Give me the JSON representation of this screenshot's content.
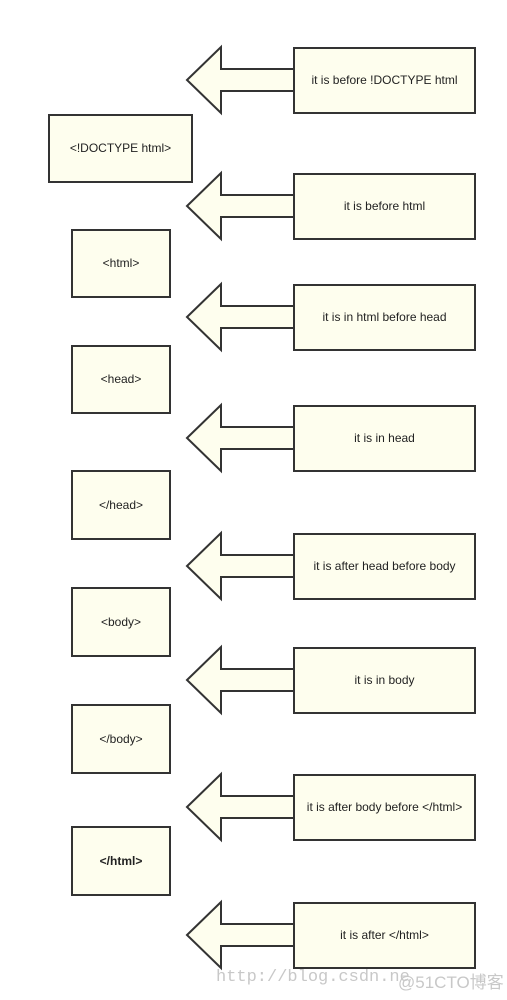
{
  "colors": {
    "fill": "#fefeee",
    "stroke": "#333333"
  },
  "tags": [
    {
      "label": "<!DOCTYPE html>",
      "bold": false
    },
    {
      "label": "<html>",
      "bold": false
    },
    {
      "label": "<head>",
      "bold": false
    },
    {
      "label": "</head>",
      "bold": false
    },
    {
      "label": "<body>",
      "bold": false
    },
    {
      "label": "</body>",
      "bold": false
    },
    {
      "label": "</html>",
      "bold": true
    }
  ],
  "states": [
    "it is before !DOCTYPE html",
    "it is before html",
    "it is in html before head",
    "it is in head",
    "it is after head before body",
    "it is in body",
    "it is after body before </html>",
    "it is after </html>"
  ],
  "watermark": {
    "url": "http://blog.csdn.ne",
    "brand": "@51CTO博客"
  }
}
